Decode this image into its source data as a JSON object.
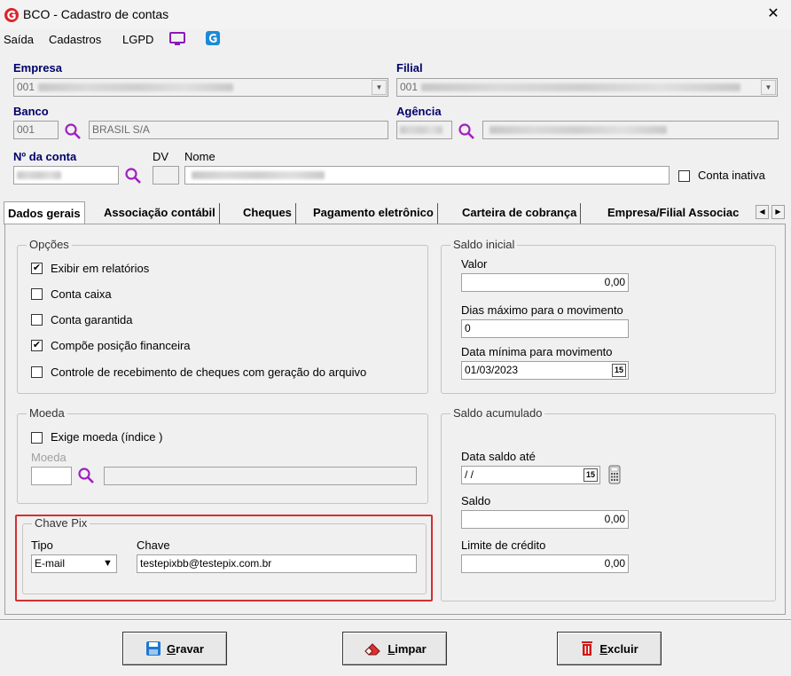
{
  "window": {
    "title": "BCO - Cadastro de contas",
    "close_glyph": "✕"
  },
  "menu": {
    "items": [
      "Saída",
      "Cadastros",
      "LGPD"
    ]
  },
  "header": {
    "empresa_label": "Empresa",
    "empresa_code": "001",
    "filial_label": "Filial",
    "filial_code": "001",
    "banco_label": "Banco",
    "banco_code": "001",
    "banco_name": "BRASIL S/A",
    "agencia_label": "Agência",
    "conta_label": "Nº da conta",
    "dv_label": "DV",
    "nome_label": "Nome",
    "conta_inativa_label": "Conta inativa"
  },
  "tabs": [
    {
      "label": "Dados gerais",
      "active": true
    },
    {
      "label": "Associação contábil",
      "active": false
    },
    {
      "label": "Cheques",
      "active": false
    },
    {
      "label": "Pagamento eletrônico",
      "active": false
    },
    {
      "label": "Carteira de cobrança",
      "active": false
    },
    {
      "label": "Empresa/Filial Associac",
      "active": false
    }
  ],
  "opcoes": {
    "title": "Opções",
    "items": [
      {
        "label": "Exibir em relatórios",
        "checked": true
      },
      {
        "label": "Conta caixa",
        "checked": false
      },
      {
        "label": "Conta garantida",
        "checked": false
      },
      {
        "label": "Compõe posição financeira",
        "checked": true
      },
      {
        "label": "Controle de recebimento de cheques com geração do arquivo",
        "checked": false
      }
    ]
  },
  "saldo_inicial": {
    "title": "Saldo inicial",
    "valor_label": "Valor",
    "valor": "0,00",
    "dias_label": "Dias máximo para o movimento",
    "dias": "0",
    "data_label": "Data mínima para movimento",
    "data": "01/03/2023",
    "calendar_glyph": "15"
  },
  "moeda": {
    "title": "Moeda",
    "exige_label": "Exige moeda (índice )",
    "exige_checked": false,
    "moeda_label": "Moeda"
  },
  "saldo_acumulado": {
    "title": "Saldo acumulado",
    "data_label": "Data saldo até",
    "data": " / /",
    "calendar_glyph": "15",
    "saldo_label": "Saldo",
    "saldo": "0,00",
    "limite_label": "Limite de crédito",
    "limite": "0,00"
  },
  "chave_pix": {
    "title": "Chave Pix",
    "tipo_label": "Tipo",
    "tipo_value": "E-mail",
    "chave_label": "Chave",
    "chave_value": "testepixbb@testepix.com.br"
  },
  "buttons": {
    "gravar_first": "G",
    "gravar_rest": "ravar",
    "limpar_first": "L",
    "limpar_rest": "impar",
    "excluir_first": "E",
    "excluir_rest": "xcluir"
  },
  "colors": {
    "label_blue": "#00006a",
    "search_purple": "#a020c0",
    "highlight_red": "#d33030"
  }
}
